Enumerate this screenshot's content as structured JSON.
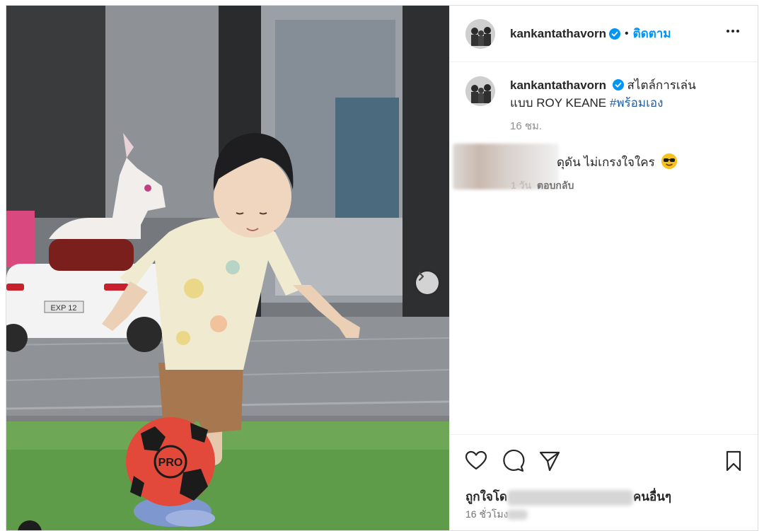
{
  "post": {
    "username": "kankantathavorn",
    "separator": "•",
    "follow_label": "ติดตาม",
    "more_label": "More options"
  },
  "caption": {
    "username": "kankantathavorn",
    "text_line1": "สไตล์การเล่น",
    "text_line2": "แบบ ROY KEANE",
    "hashtag": "#พร้อมเอง",
    "time": "16 ชม."
  },
  "comment": {
    "text": "ดุดัน ไม่เกรงใจใคร",
    "emoji": "smiling-face-with-sunglasses",
    "meta_time": "1 วัน",
    "reply_label": "ตอบกลับ"
  },
  "likes": {
    "prefix": "ถูกใจโด",
    "suffix": "คนอื่นๆ"
  },
  "post_time": {
    "text": "16 ชั่วโมง"
  },
  "photo": {
    "car_plate": "EXP 12",
    "ball_text": "PRO"
  },
  "colors": {
    "accent": "#0095f6",
    "verified": "#0095f6",
    "grass": "#5f9c4a",
    "ball": "#e2493a"
  }
}
